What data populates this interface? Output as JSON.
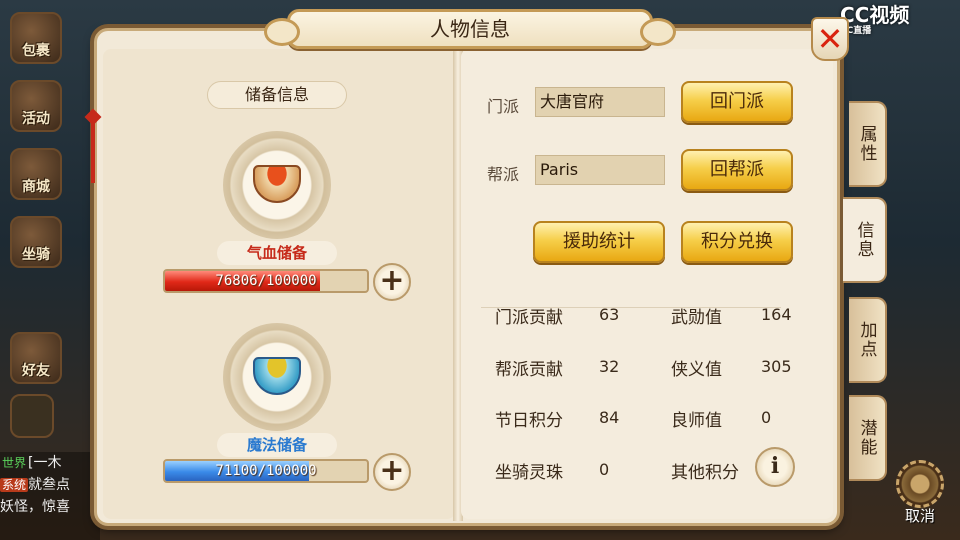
{
  "background": {
    "left_icons": [
      "包裹",
      "活动",
      "商城",
      "坐骑",
      "好友"
    ],
    "chat": {
      "line1_tag": "世界",
      "line1_text": "[一木",
      "line2_tag": "系统",
      "line2_text": "就叁点",
      "line3_text": "妖怪，惊喜"
    },
    "watermark_main": "CC视频",
    "watermark_sub": "CC直播",
    "cancel_label": "取消"
  },
  "dialog": {
    "title": "人物信息",
    "close_icon": "close-x-icon",
    "reserve": {
      "subtitle": "储备信息",
      "hp": {
        "label": "气血储备",
        "value_text": "76806/100000",
        "current": 76806,
        "max": 100000,
        "color": "#e02818"
      },
      "mp": {
        "label": "魔法储备",
        "value_text": "71100/100000",
        "current": 71100,
        "max": 100000,
        "color": "#3a8ae8"
      },
      "plus_icon": "plus-icon"
    },
    "sect": {
      "label": "门派",
      "value": "大唐官府",
      "button": "回门派"
    },
    "gang": {
      "label": "帮派",
      "value": "Paris",
      "button": "回帮派"
    },
    "buttons": {
      "aid_stats": "援助统计",
      "points_exchange": "积分兑换"
    },
    "stats": [
      {
        "label": "门派贡献",
        "value": "63"
      },
      {
        "label": "武勋值",
        "value": "164"
      },
      {
        "label": "帮派贡献",
        "value": "32"
      },
      {
        "label": "侠义值",
        "value": "305"
      },
      {
        "label": "节日积分",
        "value": "84"
      },
      {
        "label": "良师值",
        "value": "0"
      },
      {
        "label": "坐骑灵珠",
        "value": "0"
      },
      {
        "label": "其他积分",
        "value": ""
      }
    ],
    "info_icon": "info-i-icon",
    "info_glyph": "i",
    "tabs": [
      "属性",
      "信息",
      "加点",
      "潜能"
    ],
    "active_tab": "信息"
  }
}
